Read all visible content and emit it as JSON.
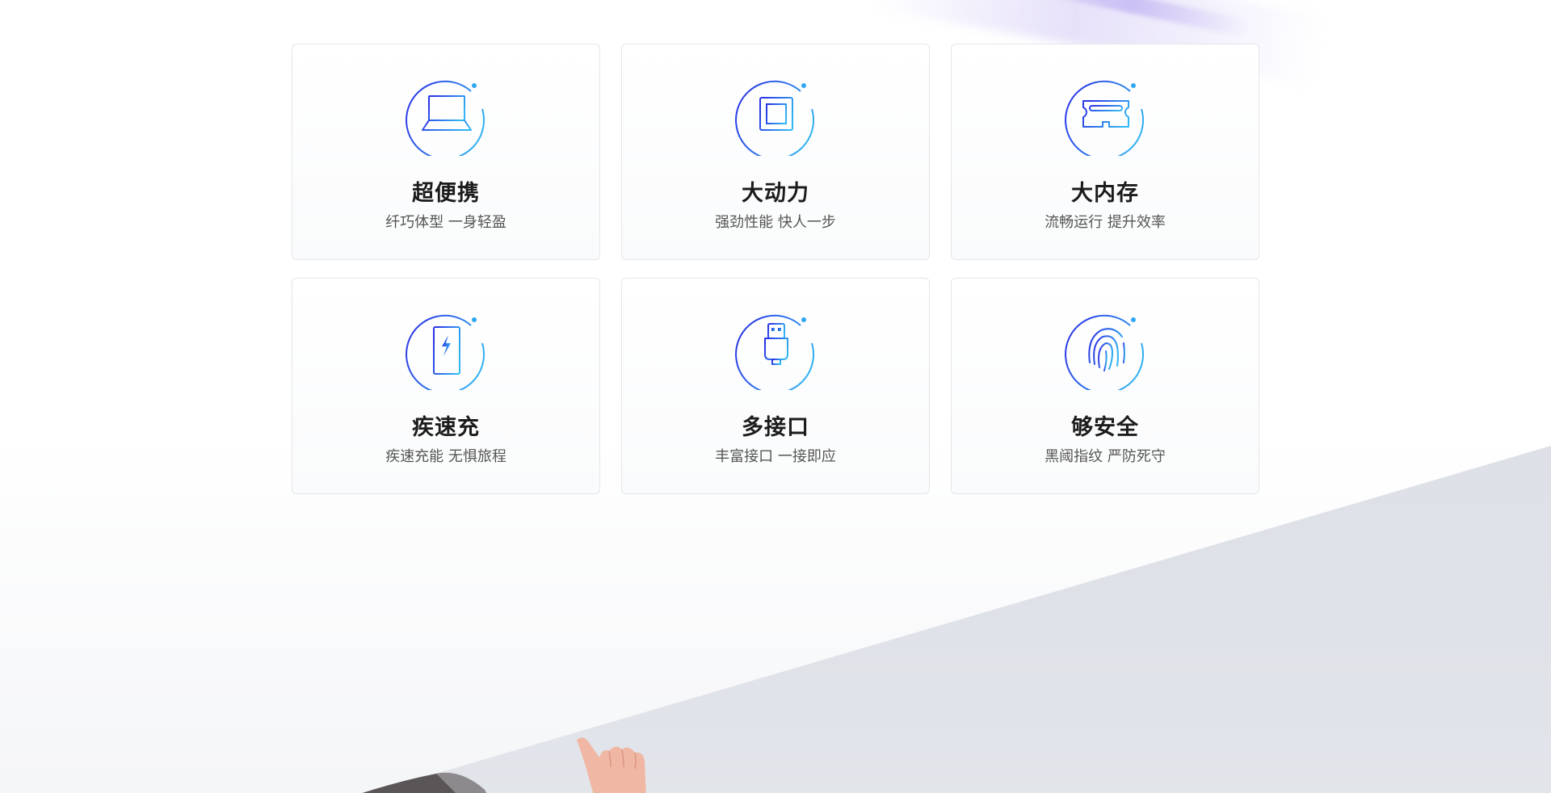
{
  "colors": {
    "icon_gradient_start": "#2b36e6",
    "icon_gradient_end": "#31b6f2",
    "title_text": "#1c1c1c",
    "subtitle_text": "#555555",
    "card_border": "#e4e6ea"
  },
  "features": [
    {
      "icon": "laptop-icon",
      "title": "超便携",
      "subtitle": "纤巧体型 一身轻盈"
    },
    {
      "icon": "cpu-chip-icon",
      "title": "大动力",
      "subtitle": "强劲性能 快人一步"
    },
    {
      "icon": "memory-module-icon",
      "title": "大内存",
      "subtitle": "流畅运行 提升效率"
    },
    {
      "icon": "battery-charging-icon",
      "title": "疾速充",
      "subtitle": "疾速充能 无惧旅程"
    },
    {
      "icon": "usb-plug-icon",
      "title": "多接口",
      "subtitle": "丰富接口 一接即应"
    },
    {
      "icon": "fingerprint-icon",
      "title": "够安全",
      "subtitle": "黑阈指纹 严防死守"
    }
  ]
}
